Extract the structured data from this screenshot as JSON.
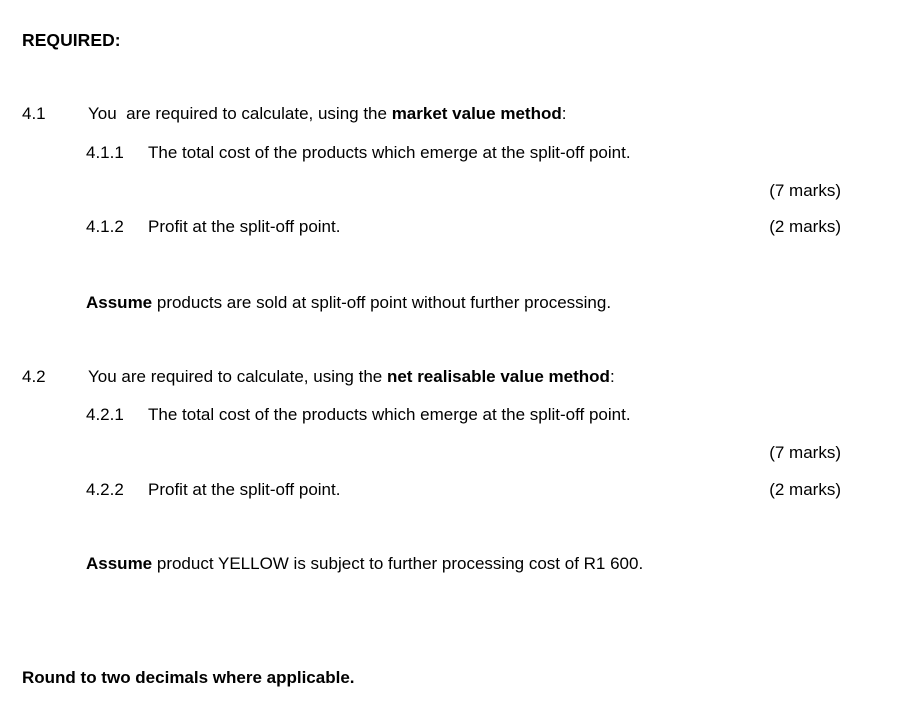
{
  "document": {
    "heading": "REQUIRED:",
    "background_color": "#ffffff",
    "text_color": "#000000"
  },
  "questions": [
    {
      "number": "4.1",
      "stem_before": "You  are required to calculate, using the ",
      "stem_bold": "market value method",
      "stem_after": ":",
      "sub_items": [
        {
          "number": "4.1.1",
          "text": "The total cost of the products which emerge at the split-off point.",
          "marks": "(7 marks)"
        },
        {
          "number": "4.1.2",
          "text": "Profit at the split-off point.",
          "marks": "(2 marks)"
        }
      ],
      "assume_bold": "Assume",
      "assume_rest": " products are sold at split-off point without further processing."
    },
    {
      "number": "4.2",
      "stem_before": "You are required to calculate, using the ",
      "stem_bold": "net realisable value method",
      "stem_after": ":",
      "sub_items": [
        {
          "number": "4.2.1",
          "text": "The total cost of the products which emerge at the split-off point.",
          "marks": "(7 marks)"
        },
        {
          "number": "4.2.2",
          "text": "Profit at the split-off point.",
          "marks": "(2 marks)"
        }
      ],
      "assume_bold": "Assume",
      "assume_rest": " product YELLOW is subject to further processing cost of R1 600."
    }
  ],
  "footer_note": "Round to two decimals where applicable."
}
